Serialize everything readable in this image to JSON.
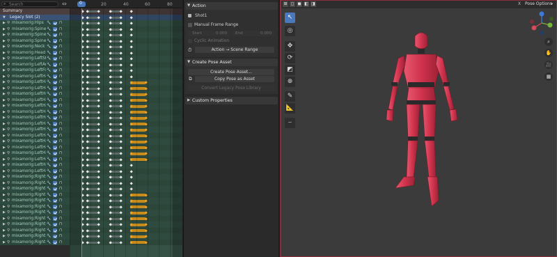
{
  "dopesheet": {
    "search_placeholder": "Search",
    "current_frame": "0",
    "frame_ticks": [
      "20",
      "40",
      "60",
      "80"
    ],
    "summary_label": "Summary",
    "slot_label": "Legacy Slot (2)",
    "bones": [
      "mixamorig:Hips",
      "mixamorig:Spine",
      "mixamorig:Spine1",
      "mixamorig:Spine2",
      "mixamorig:Neck",
      "mixamorig:Head",
      "mixamorig:LeftSh",
      "mixamorig:LeftAr",
      "mixamorig:LeftFo",
      "mixamorig:LeftHa",
      "mixamorig:LeftHa",
      "mixamorig:LeftHa",
      "mixamorig:LeftHa",
      "mixamorig:LeftHa",
      "mixamorig:LeftHa",
      "mixamorig:LeftHa",
      "mixamorig:LeftHa",
      "mixamorig:LeftHa",
      "mixamorig:LeftHa",
      "mixamorig:LeftHa",
      "mixamorig:LeftHa",
      "mixamorig:LeftHa",
      "mixamorig:LeftHa",
      "mixamorig:LeftHa",
      "mixamorig:LeftHa",
      "mixamorig:LeftHa",
      "mixamorig:RightS",
      "mixamorig:RightA",
      "mixamorig:RightF",
      "mixamorig:RightH",
      "mixamorig:RightH",
      "mixamorig:RightH",
      "mixamorig:RightH",
      "mixamorig:RightH",
      "mixamorig:RightH",
      "mixamorig:RightH",
      "mixamorig:RightH",
      "mixamorig:RightH"
    ]
  },
  "action_panel": {
    "title": "Action",
    "action_name": "Shot1",
    "manual_frame_range": "Manual Frame Range",
    "start_label": "Start",
    "start_value": "0.000",
    "end_label": "End",
    "end_value": "0.000",
    "cyclic": "Cyclic Animation",
    "to_scene_range": "Action → Scene Range"
  },
  "pose_panel": {
    "title": "Create Pose Asset",
    "create": "Create Pose Asset...",
    "copy": "Copy Pose as Asset",
    "convert": "Convert Legacy Pose Library"
  },
  "custom_props": {
    "title": "Custom Properties"
  },
  "viewport": {
    "pose_options": "Pose Options",
    "close": "X",
    "tools": [
      "select-tool",
      "cursor-tool",
      "move-tool",
      "rotate-tool",
      "scale-tool",
      "transform-tool",
      "annotate-tool",
      "measure-tool",
      "relax-tool"
    ],
    "accent_color": "#4a78bd",
    "model_color": "#d0334d"
  }
}
